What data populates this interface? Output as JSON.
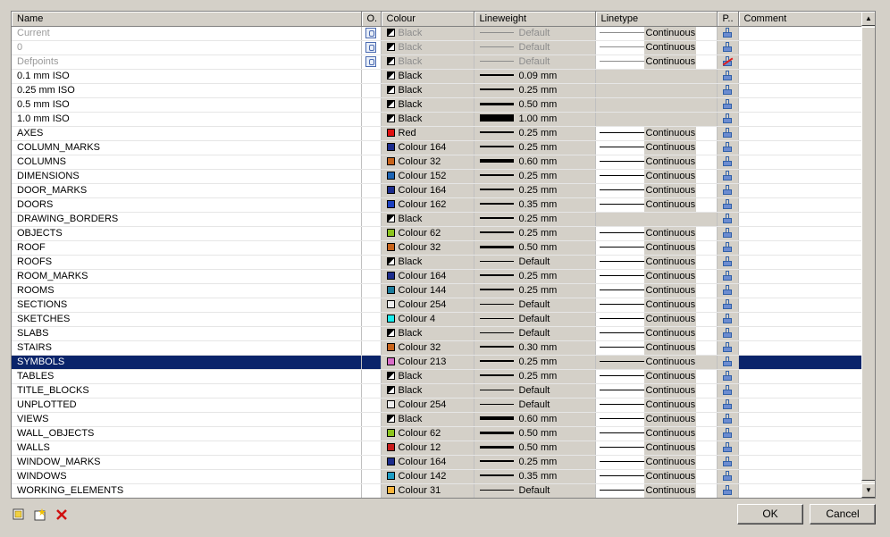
{
  "columns": [
    "Name",
    "O.",
    "Colour",
    "Lineweight",
    "Linetype",
    "P..",
    "Comment"
  ],
  "layers": [
    {
      "name": "Current",
      "colour": "Black",
      "sw": "bw",
      "lw": "Default",
      "lt": "Continuous",
      "ro": true,
      "on": true
    },
    {
      "name": "0",
      "colour": "Black",
      "sw": "bw",
      "lw": "Default",
      "lt": "Continuous",
      "ro": true,
      "on": true
    },
    {
      "name": "Defpoints",
      "colour": "Black",
      "sw": "bw",
      "lw": "Default",
      "lt": "Continuous",
      "ro": true,
      "on": true,
      "noplot": true
    },
    {
      "name": "0.1 mm ISO",
      "colour": "Black",
      "sw": "bw",
      "lw": "0.09 mm",
      "lt": ""
    },
    {
      "name": "0.25 mm ISO",
      "colour": "Black",
      "sw": "bw",
      "lw": "0.25 mm",
      "lt": ""
    },
    {
      "name": "0.5 mm ISO",
      "colour": "Black",
      "sw": "bw",
      "lw": "0.50 mm",
      "lt": ""
    },
    {
      "name": "1.0 mm ISO",
      "colour": "Black",
      "sw": "bw",
      "lw": "1.00 mm",
      "lt": ""
    },
    {
      "name": "AXES",
      "colour": "Red",
      "sw": "#e01010",
      "lw": "0.25 mm",
      "lt": "Continuous"
    },
    {
      "name": "COLUMN_MARKS",
      "colour": "Colour 164",
      "sw": "#1c2c8c",
      "lw": "0.25 mm",
      "lt": "Continuous"
    },
    {
      "name": "COLUMNS",
      "colour": "Colour 32",
      "sw": "#c8641c",
      "lw": "0.60 mm",
      "lt": "Continuous"
    },
    {
      "name": "DIMENSIONS",
      "colour": "Colour 152",
      "sw": "#1c64b4",
      "lw": "0.25 mm",
      "lt": "Continuous"
    },
    {
      "name": "DOOR_MARKS",
      "colour": "Colour 164",
      "sw": "#1c2c8c",
      "lw": "0.25 mm",
      "lt": "Continuous"
    },
    {
      "name": "DOORS",
      "colour": "Colour 162",
      "sw": "#1c40c0",
      "lw": "0.35 mm",
      "lt": "Continuous"
    },
    {
      "name": "DRAWING_BORDERS",
      "colour": "Black",
      "sw": "bw",
      "lw": "0.25 mm",
      "lt": ""
    },
    {
      "name": "OBJECTS",
      "colour": "Colour 62",
      "sw": "#8cc41c",
      "lw": "0.25 mm",
      "lt": "Continuous"
    },
    {
      "name": "ROOF",
      "colour": "Colour 32",
      "sw": "#c8641c",
      "lw": "0.50 mm",
      "lt": "Continuous"
    },
    {
      "name": "ROOFS",
      "colour": "Black",
      "sw": "bw",
      "lw": "Default",
      "lt": "Continuous"
    },
    {
      "name": "ROOM_MARKS",
      "colour": "Colour 164",
      "sw": "#1c2c8c",
      "lw": "0.25 mm",
      "lt": "Continuous"
    },
    {
      "name": "ROOMS",
      "colour": "Colour 144",
      "sw": "#1c7c9c",
      "lw": "0.25 mm",
      "lt": "Continuous"
    },
    {
      "name": "SECTIONS",
      "colour": "Colour 254",
      "sw": "#ececec",
      "lw": "Default",
      "lt": "Continuous"
    },
    {
      "name": "SKETCHES",
      "colour": "Colour 4",
      "sw": "#1cecec",
      "lw": "Default",
      "lt": "Continuous"
    },
    {
      "name": "SLABS",
      "colour": "Black",
      "sw": "bw",
      "lw": "Default",
      "lt": "Continuous"
    },
    {
      "name": "STAIRS",
      "colour": "Colour 32",
      "sw": "#c8641c",
      "lw": "0.30 mm",
      "lt": "Continuous"
    },
    {
      "name": "SYMBOLS",
      "colour": "Colour 213",
      "sw": "#d86cc8",
      "lw": "0.25 mm",
      "lt": "Continuous",
      "sel": true
    },
    {
      "name": "TABLES",
      "colour": "Black",
      "sw": "bw",
      "lw": "0.25 mm",
      "lt": "Continuous"
    },
    {
      "name": "TITLE_BLOCKS",
      "colour": "Black",
      "sw": "bw",
      "lw": "Default",
      "lt": "Continuous"
    },
    {
      "name": "UNPLOTTED",
      "colour": "Colour 254",
      "sw": "#ececec",
      "lw": "Default",
      "lt": "Continuous"
    },
    {
      "name": "VIEWS",
      "colour": "Black",
      "sw": "bw",
      "lw": "0.60 mm",
      "lt": "Continuous"
    },
    {
      "name": "WALL_OBJECTS",
      "colour": "Colour 62",
      "sw": "#8cc41c",
      "lw": "0.50 mm",
      "lt": "Continuous"
    },
    {
      "name": "WALLS",
      "colour": "Colour 12",
      "sw": "#c81c1c",
      "lw": "0.50 mm",
      "lt": "Continuous"
    },
    {
      "name": "WINDOW_MARKS",
      "colour": "Colour 164",
      "sw": "#1c2c8c",
      "lw": "0.25 mm",
      "lt": "Continuous"
    },
    {
      "name": "WINDOWS",
      "colour": "Colour 142",
      "sw": "#1c9cc4",
      "lw": "0.35 mm",
      "lt": "Continuous"
    },
    {
      "name": "WORKING_ELEMENTS",
      "colour": "Colour 31",
      "sw": "#f8b43c",
      "lw": "Default",
      "lt": "Continuous"
    }
  ],
  "buttons": {
    "ok": "OK",
    "cancel": "Cancel"
  },
  "colors": {
    "selection": "#0a246a",
    "face": "#d4d0c8"
  }
}
